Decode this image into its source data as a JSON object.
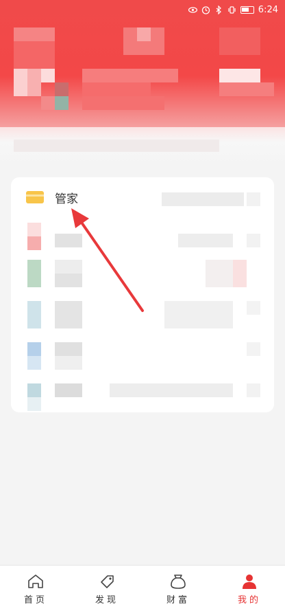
{
  "status_bar": {
    "time": "6:24",
    "icons": [
      "eye-icon",
      "alarm-icon",
      "bluetooth-icon",
      "vibrate-icon",
      "battery-icon"
    ]
  },
  "card": {
    "title": "管家",
    "icon": "wallet-icon"
  },
  "nav": {
    "items": [
      {
        "label": "首页",
        "icon": "home-icon",
        "active": false
      },
      {
        "label": "发现",
        "icon": "tag-icon",
        "active": false
      },
      {
        "label": "财富",
        "icon": "money-bag-icon",
        "active": false
      },
      {
        "label": "我的",
        "icon": "person-icon",
        "active": true
      }
    ]
  },
  "colors": {
    "header": "#f04a4a",
    "accent": "#e63333",
    "wallet": "#f8c54a"
  }
}
